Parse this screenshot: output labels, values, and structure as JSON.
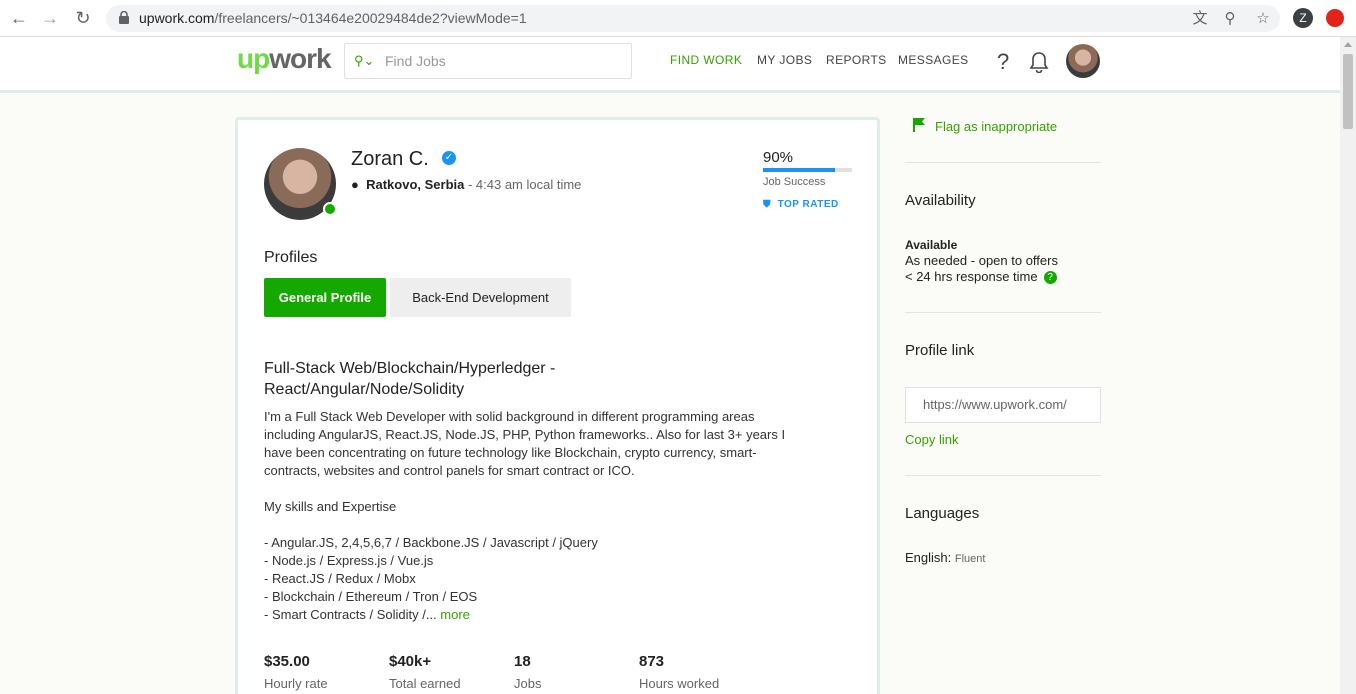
{
  "browser": {
    "url_main": "upwork.com",
    "url_path": "/freelancers/~013464e20029484de2?viewMode=1",
    "profile_initial": "Z"
  },
  "header": {
    "logo_up": "up",
    "logo_work": "work",
    "search_placeholder": "Find Jobs",
    "nav": [
      "FIND WORK",
      "MY JOBS",
      "REPORTS",
      "MESSAGES"
    ],
    "help_symbol": "?"
  },
  "profile": {
    "name": "Zoran C.",
    "location": "Ratkovo, Serbia",
    "local_time": " - 4:43 am local time",
    "job_success": "90%",
    "job_success_fraction": 0.9,
    "job_success_label": "Job Success",
    "top_rated": "TOP RATED",
    "profiles_heading": "Profiles",
    "profile_tabs": [
      "General Profile",
      "Back-End Development"
    ],
    "title": "Full-Stack Web/Blockchain/Hyperledger - React/Angular/Node/Solidity",
    "description": "I'm a Full Stack Web Developer with solid background in different programming areas\nincluding AngularJS, React.JS, Node.JS, PHP, Python frameworks.. Also for last 3+ years I\nhave been concentrating on future technology like Blockchain, crypto currency, smart-\ncontracts, websites and control panels for smart contract or ICO.\n\nMy skills and Expertise\n\n- Angular.JS, 2,4,5,6,7 / Backbone.JS / Javascript / jQuery\n- Node.js / Express.js / Vue.js\n- React.JS / Redux / Mobx\n- Blockchain / Ethereum / Tron / EOS\n- Smart Contracts / Solidity /...",
    "more_link": "more",
    "stats": [
      {
        "value": "$35.00",
        "label": "Hourly rate"
      },
      {
        "value": "$40k+",
        "label": "Total earned"
      },
      {
        "value": "18",
        "label": "Jobs"
      },
      {
        "value": "873",
        "label": "Hours worked"
      }
    ]
  },
  "sidebar": {
    "flag": "Flag as inappropriate",
    "availability_heading": "Availability",
    "available": "Available",
    "as_needed": "As needed - open to offers",
    "response": "< 24 hrs response time",
    "profile_link_heading": "Profile link",
    "profile_link_value": "https://www.upwork.com/",
    "copy_link": "Copy link",
    "languages_heading": "Languages",
    "language": "English:",
    "language_level": "Fluent"
  },
  "colors": {
    "brand_green": "#14a800",
    "link_green": "#37a000",
    "accent_blue": "#1b93f5"
  }
}
